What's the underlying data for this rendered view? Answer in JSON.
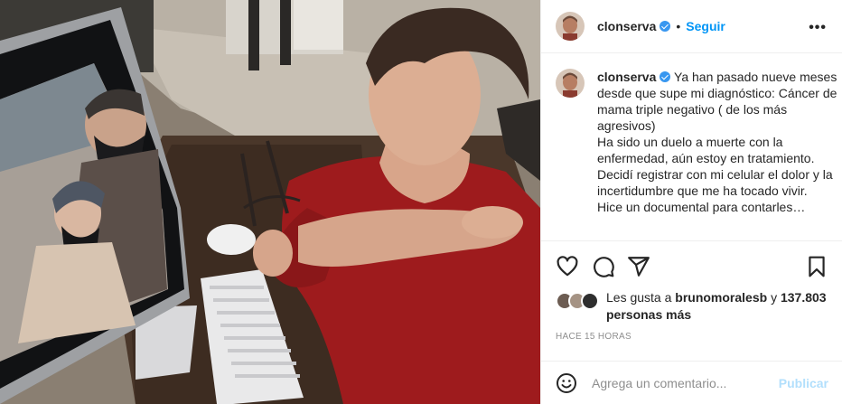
{
  "post": {
    "image_alt": "",
    "colors": {
      "accent": "#0095f6",
      "verified": "#3897f0",
      "publish_disabled": "#b2dffc",
      "muted": "#8e8e8e"
    }
  },
  "header": {
    "username": "clonserva",
    "separator": "•",
    "follow_label": "Seguir",
    "more_icon": "more-horizontal-icon"
  },
  "caption": {
    "username": "clonserva",
    "lines": [
      "Ya han pasado nueve meses desde que supe mi diagnóstico: Cáncer de mama triple negativo ( de los más agresivos)",
      "Ha sido un duelo a muerte con la enfermedad, aún estoy en tratamiento.",
      "Decidí registrar con mi celular el dolor y la incertidumbre que me ha tocado vivir.",
      "Hice un documental para contarles…"
    ]
  },
  "actions": {
    "icons": [
      "heart-icon",
      "comment-icon",
      "share-icon",
      "bookmark-icon"
    ]
  },
  "likes": {
    "prefix": "Les gusta a",
    "user": "brunomoralesb",
    "conjunction": "y",
    "count": "137.803",
    "suffix": "personas más"
  },
  "timestamp": "HACE 15 HORAS",
  "comment": {
    "placeholder": "Agrega un comentario...",
    "publish_label": "Publicar",
    "emoji_icon": "emoji-icon"
  }
}
